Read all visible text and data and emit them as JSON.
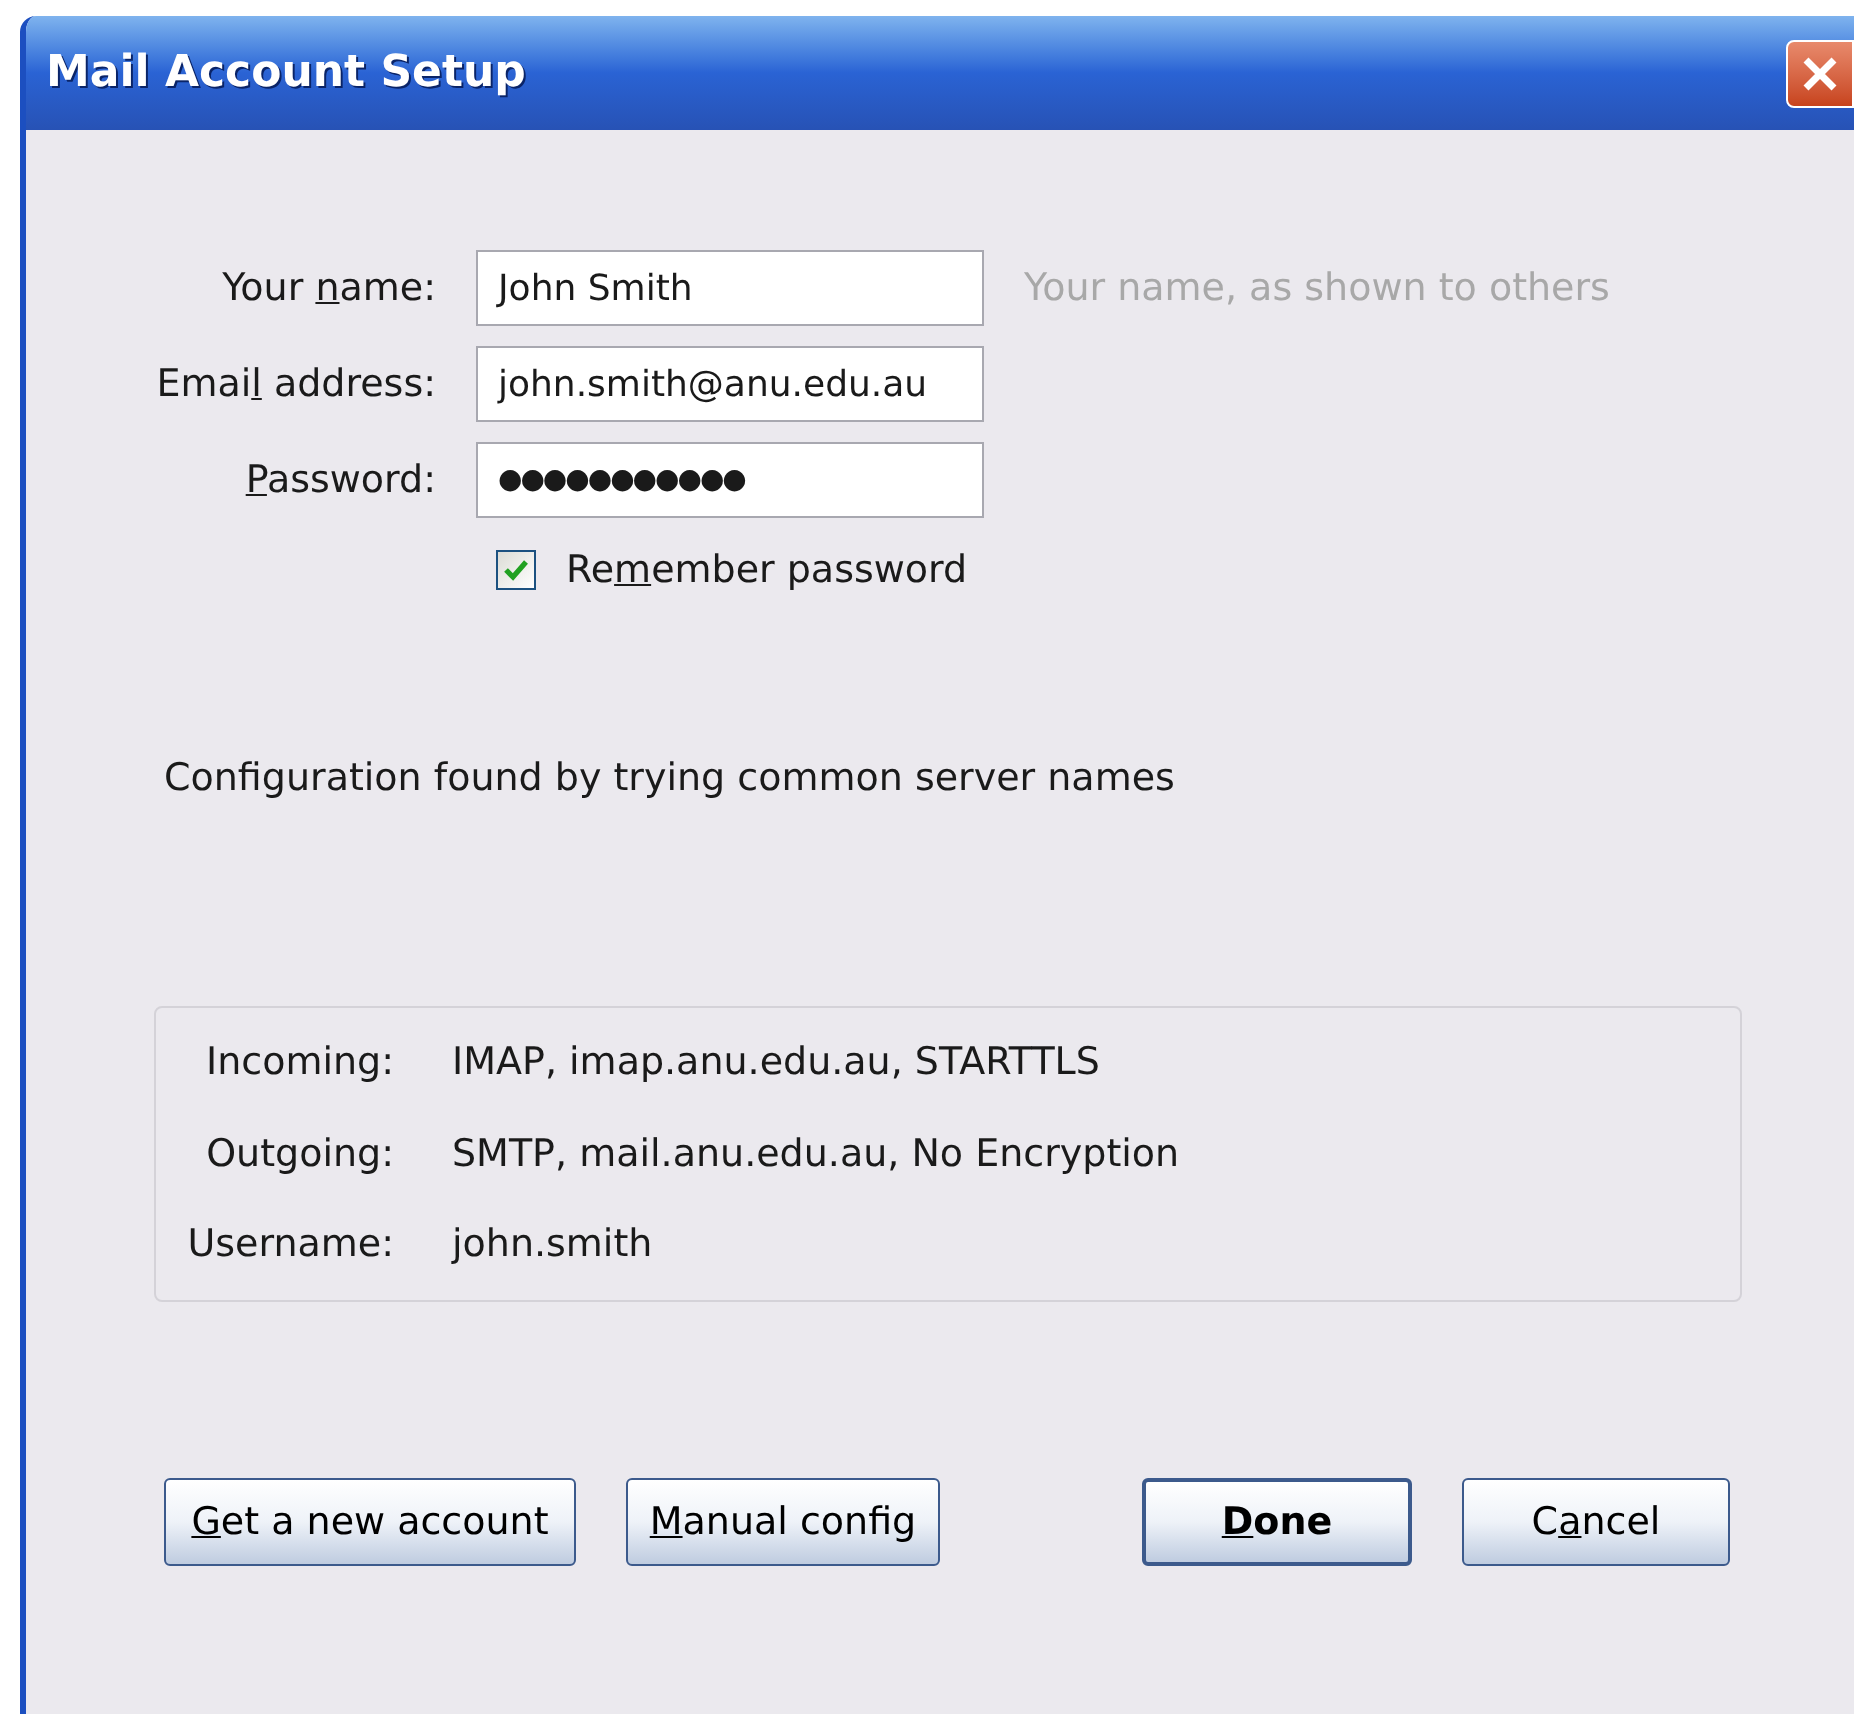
{
  "window": {
    "title": "Mail Account Setup"
  },
  "fields": [
    {
      "label": {
        "before": "Your ",
        "key": "n",
        "after": "ame:"
      },
      "value": "John Smith",
      "hint": "Your name, as shown to others"
    },
    {
      "label": {
        "before": "Emai",
        "key": "l",
        "after": " address:"
      },
      "value": "john.smith@anu.edu.au"
    },
    {
      "label": {
        "key": "P",
        "after": "assword:"
      },
      "value": "●●●●●●●●●●●"
    }
  ],
  "remember": {
    "label": {
      "before": "Re",
      "key": "m",
      "after": "ember password"
    },
    "checked": true
  },
  "status": "Configuration found by trying common server names",
  "config": [
    {
      "label": "Incoming:",
      "value": "IMAP, imap.anu.edu.au, STARTTLS"
    },
    {
      "label": "Outgoing:",
      "value": "SMTP, mail.anu.edu.au, No Encryption"
    },
    {
      "label": "Username:",
      "value": "john.smith"
    }
  ],
  "buttons": [
    {
      "label": {
        "key": "G",
        "after": "et a new account"
      },
      "default": false
    },
    {
      "label": {
        "key": "M",
        "after": "anual config"
      },
      "default": false
    },
    {
      "label": {
        "key": "D",
        "after": "one"
      },
      "default": true
    },
    {
      "label": {
        "before": "C",
        "key": "a",
        "after": "ncel"
      },
      "default": false
    }
  ]
}
